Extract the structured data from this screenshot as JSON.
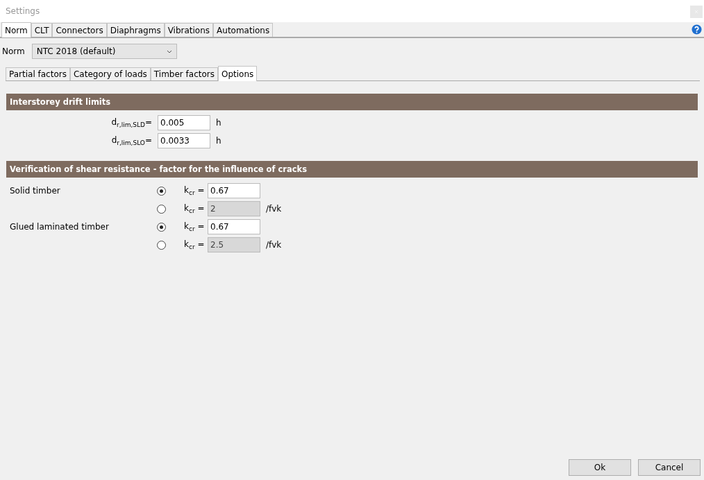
{
  "window": {
    "title": "Settings"
  },
  "tabs": [
    {
      "label": "Norm",
      "selected": true
    },
    {
      "label": "CLT",
      "selected": false
    },
    {
      "label": "Connectors",
      "selected": false
    },
    {
      "label": "Diaphragms",
      "selected": false
    },
    {
      "label": "Vibrations",
      "selected": false
    },
    {
      "label": "Automations",
      "selected": false
    }
  ],
  "norm": {
    "label": "Norm",
    "value": "NTC 2018  (default)"
  },
  "subtabs": [
    {
      "label": "Partial factors",
      "selected": false
    },
    {
      "label": "Category of loads",
      "selected": false
    },
    {
      "label": "Timber factors",
      "selected": false
    },
    {
      "label": "Options",
      "selected": true
    }
  ],
  "drift": {
    "title": "Interstorey drift limits",
    "fields": [
      {
        "label": "d$_{r,lim,SLD}$=",
        "value": "0.005",
        "unit": "h"
      },
      {
        "label": "d$_{r,lim,SLO}$=",
        "value": "0.0033",
        "unit": "h"
      }
    ]
  },
  "shear": {
    "title": "Verification of shear resistance - factor for the influence of cracks",
    "rows": [
      {
        "label": "Solid timber",
        "selected": true,
        "symbol": "k$_{cr}$ =",
        "value": "0.67",
        "disabled": false
      },
      {
        "selected": false,
        "symbol": "k$_{cr}$ =",
        "value": "2",
        "disabled": true,
        "unit": "/fvk"
      },
      {
        "label": "Glued laminated timber",
        "selected": true,
        "symbol": "k$_{cr}$ =",
        "value": "0.67",
        "disabled": false
      },
      {
        "selected": false,
        "symbol": "k$_{cr}$ =",
        "value": "2.5",
        "disabled": true,
        "unit": "/fvk"
      }
    ]
  },
  "buttons": [
    "Ok",
    "Cancel"
  ]
}
